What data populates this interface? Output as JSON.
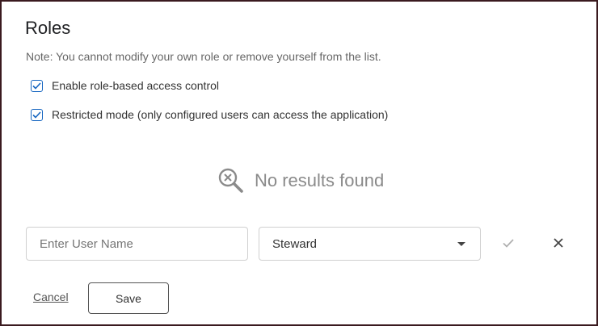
{
  "dialog": {
    "title": "Roles",
    "note": "Note: You cannot modify your own role or remove yourself from the list."
  },
  "options": [
    {
      "label": "Enable role-based access control",
      "checked": true
    },
    {
      "label": "Restricted mode (only configured users can access the application)",
      "checked": true
    }
  ],
  "empty_state": {
    "icon": "search-no-results-icon",
    "text": "No results found"
  },
  "add_user": {
    "username_placeholder": "Enter User Name",
    "username_value": "",
    "role_selected": "Steward",
    "confirm_icon": "check-icon",
    "discard_icon": "close-icon"
  },
  "actions": {
    "cancel_label": "Cancel",
    "save_label": "Save"
  },
  "colors": {
    "checkbox_accent": "#1565c0",
    "frame_border": "#3a1a1f",
    "muted_text": "#8a8a8a"
  }
}
